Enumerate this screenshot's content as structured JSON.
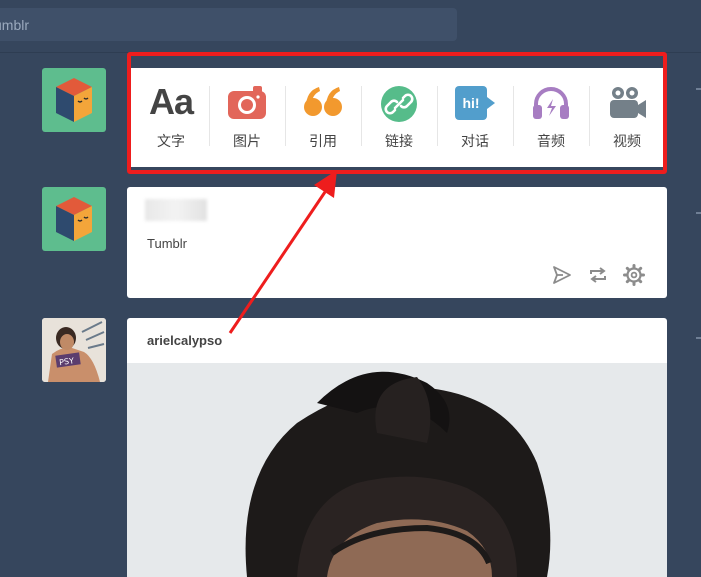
{
  "search": {
    "placeholder": "umblr"
  },
  "composer": {
    "items": [
      {
        "label": "文字",
        "icon": "text-icon",
        "glyph": "Aa",
        "color": "#444444"
      },
      {
        "label": "图片",
        "icon": "camera-icon",
        "color": "#e2665a"
      },
      {
        "label": "引用",
        "icon": "quote-icon",
        "color": "#f2992e"
      },
      {
        "label": "链接",
        "icon": "link-icon",
        "color": "#56bc8a"
      },
      {
        "label": "对话",
        "icon": "chat-icon",
        "glyph": "hi!",
        "color": "#529ecc"
      },
      {
        "label": "音频",
        "icon": "headphones-icon",
        "color": "#a77dc2"
      },
      {
        "label": "视频",
        "icon": "video-camera-icon",
        "color": "#748089"
      }
    ]
  },
  "posts": [
    {
      "blog": "Tumblr",
      "actions": [
        "send-icon",
        "reblog-icon",
        "gear-icon"
      ]
    },
    {
      "blog": "arielcalypso"
    }
  ],
  "annotation": {
    "box_color": "#ee1d1d",
    "arrow_color": "#ee1d1d"
  }
}
